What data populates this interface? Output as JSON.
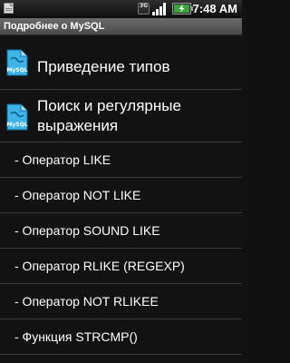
{
  "status_bar": {
    "network_label": "3G",
    "time": "7:48 AM"
  },
  "title_bar": {
    "title": "Подробнее о MySQL"
  },
  "icons": {
    "file_icon_label": "MySQL",
    "accent": "#1d8fc6"
  },
  "list": {
    "sections": [
      {
        "label": "Приведение типов"
      },
      {
        "label": "Поиск и регулярные выражения"
      }
    ],
    "items": [
      {
        "label": "- Оператор LIKE"
      },
      {
        "label": "- Оператор NOT LIKE"
      },
      {
        "label": "- Оператор SOUND LIKE"
      },
      {
        "label": "- Оператор RLIKE (REGEXP)"
      },
      {
        "label": "- Оператор NOT RLIKEE"
      },
      {
        "label": "- Функция STRCMP()"
      }
    ]
  }
}
